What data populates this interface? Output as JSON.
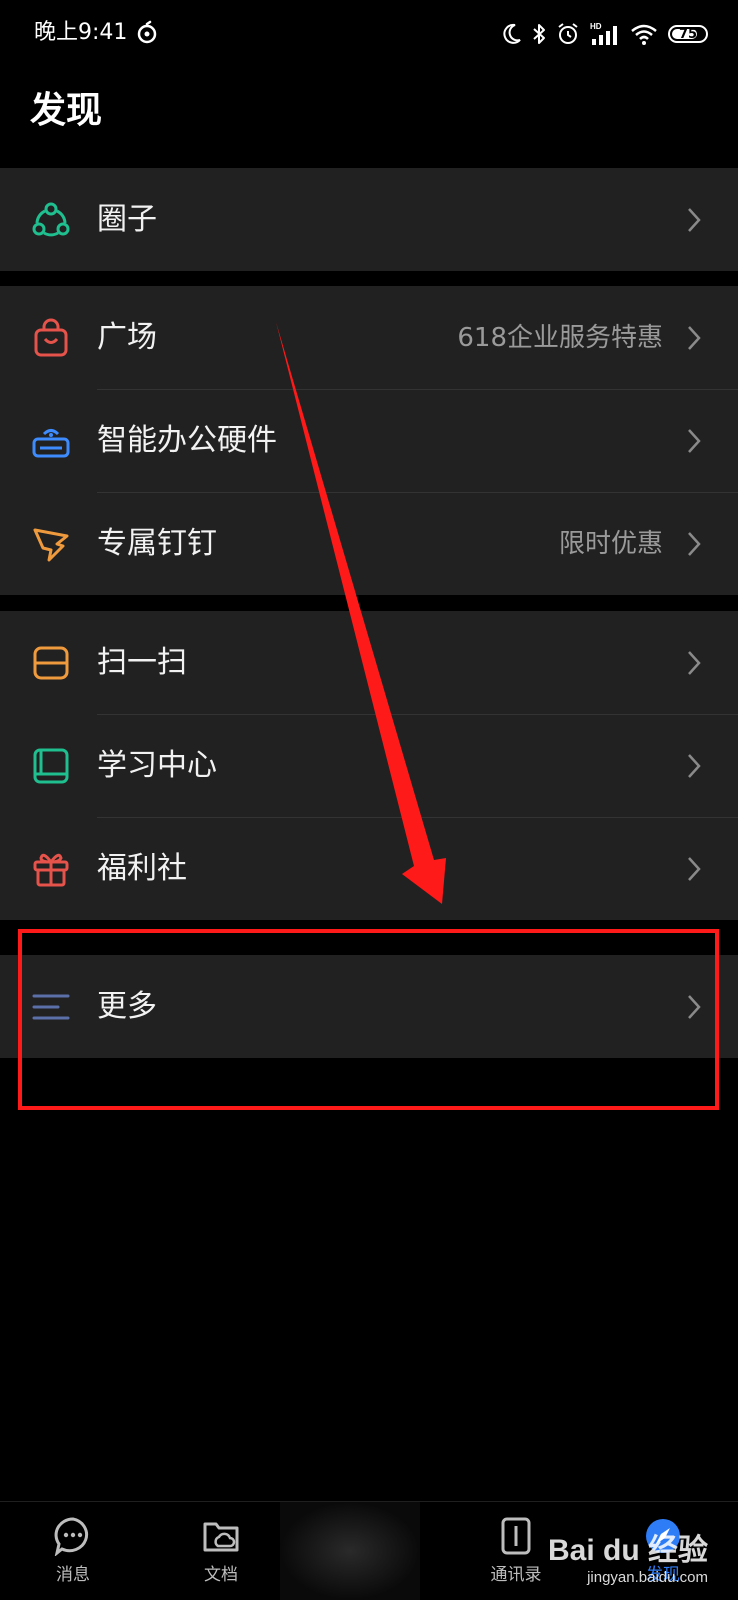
{
  "status_bar": {
    "time": "晚上9:41",
    "battery": "75"
  },
  "page_title": "发现",
  "groups": [
    {
      "items": [
        {
          "label": "圈子",
          "sub": "",
          "icon": "circle-people-icon",
          "color": "#1fbf8f"
        }
      ]
    },
    {
      "items": [
        {
          "label": "广场",
          "sub": "618企业服务特惠",
          "icon": "shopping-bag-icon",
          "color": "#e5534b"
        },
        {
          "label": "智能办公硬件",
          "sub": "",
          "icon": "router-icon",
          "color": "#3d8bfd"
        },
        {
          "label": "专属钉钉",
          "sub": "限时优惠",
          "icon": "dingtalk-wing-icon",
          "color": "#f09a3e"
        }
      ]
    },
    {
      "items": [
        {
          "label": "扫一扫",
          "sub": "",
          "icon": "scan-icon",
          "color": "#f09a3e"
        },
        {
          "label": "学习中心",
          "sub": "",
          "icon": "book-icon",
          "color": "#1fbf8f"
        },
        {
          "label": "福利社",
          "sub": "",
          "icon": "gift-icon",
          "color": "#e5534b"
        }
      ]
    },
    {
      "items": [
        {
          "label": "更多",
          "sub": "",
          "icon": "menu-lines-icon",
          "color": "#5b6fa8"
        }
      ]
    }
  ],
  "tabbar": {
    "items": [
      {
        "label": "消息",
        "icon": "chat-bubble-icon"
      },
      {
        "label": "文档",
        "icon": "folder-cloud-icon"
      },
      {
        "label": "通讯录",
        "icon": "contacts-book-icon"
      },
      {
        "label": "发现",
        "icon": "compass-icon"
      }
    ]
  },
  "watermark": {
    "main": "Bai du 经验",
    "sub": "jingyan.baidu.com"
  },
  "annotation": {
    "color": "#ff1a1a"
  }
}
